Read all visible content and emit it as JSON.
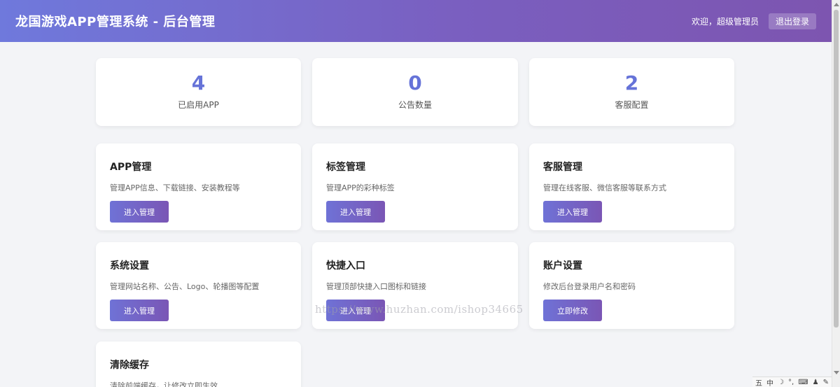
{
  "header": {
    "title": "龙国游戏APP管理系统 - 后台管理",
    "welcome": "欢迎，超级管理员",
    "logout_label": "退出登录"
  },
  "stats": [
    {
      "value": "4",
      "label": "已启用APP"
    },
    {
      "value": "0",
      "label": "公告数量"
    },
    {
      "value": "2",
      "label": "客服配置"
    }
  ],
  "modules": [
    {
      "title": "APP管理",
      "desc": "管理APP信息、下载链接、安装教程等",
      "button": "进入管理"
    },
    {
      "title": "标签管理",
      "desc": "管理APP的彩种标签",
      "button": "进入管理"
    },
    {
      "title": "客服管理",
      "desc": "管理在线客服、微信客服等联系方式",
      "button": "进入管理"
    },
    {
      "title": "系统设置",
      "desc": "管理网站名称、公告、Logo、轮播图等配置",
      "button": "进入管理"
    },
    {
      "title": "快捷入口",
      "desc": "管理顶部快捷入口图标和链接",
      "button": "进入管理"
    },
    {
      "title": "账户设置",
      "desc": "修改后台登录用户名和密码",
      "button": "立即修改"
    },
    {
      "title": "清除缓存",
      "desc": "清除前端缓存，让修改立即生效",
      "button": ""
    }
  ],
  "watermark": "https://www.huzhan.com/ishop34665",
  "tray": [
    "五",
    "中"
  ],
  "colors": {
    "accent": "#6673d8",
    "header_start": "#6f79dc",
    "header_end": "#7d55b0"
  }
}
